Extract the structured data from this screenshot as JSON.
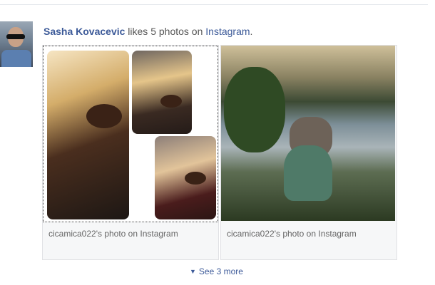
{
  "story": {
    "actor_name": "Sasha Kovacevic",
    "action_text": " likes 5 photos on ",
    "app_name": "Instagram",
    "trailing": "."
  },
  "photos": [
    {
      "caption": "cicamica022's photo on Instagram"
    },
    {
      "caption": "cicamica022's photo on Instagram"
    }
  ],
  "see_more": {
    "icon": "caret-down-icon",
    "label": "See 3 more"
  },
  "colors": {
    "link": "#3b5998",
    "text": "#555555",
    "card_bg": "#f6f7f8"
  }
}
